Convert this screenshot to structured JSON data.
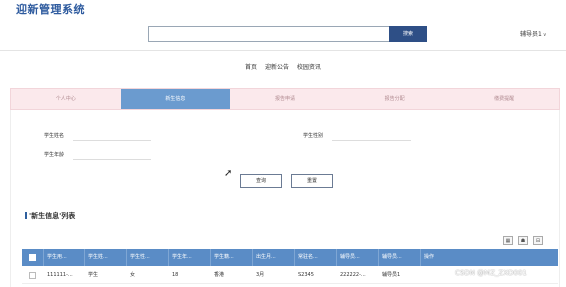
{
  "header": {
    "app_title": "迎新管理系统",
    "search_placeholder": "",
    "search_button": "搜索",
    "user_menu": "辅导员1",
    "user_menu_icon": "chevron-down-icon"
  },
  "main_nav": [
    "首页",
    "迎新公告",
    "校园资讯"
  ],
  "tabs": [
    {
      "label": "个人中心",
      "active": false
    },
    {
      "label": "新生信息",
      "active": true
    },
    {
      "label": "报告申请",
      "active": false
    },
    {
      "label": "报告分配",
      "active": false
    },
    {
      "label": "缴费提醒",
      "active": false
    }
  ],
  "filters": {
    "name_label": "学生姓名",
    "gender_label": "学生性别",
    "age_label": "学生年龄",
    "name_value": "",
    "gender_value": "",
    "age_value": ""
  },
  "buttons": {
    "query": "查询",
    "reset": "重置"
  },
  "section": {
    "title": "'新生信息'列表"
  },
  "toolbar_icons": [
    "table-icon",
    "user-icon",
    "print-icon"
  ],
  "table": {
    "columns": [
      "学生用...",
      "学生姓...",
      "学生性...",
      "学生年...",
      "学生籍...",
      "出生月...",
      "常驻名...",
      "辅导员...",
      "辅导员...",
      "操作"
    ],
    "rows": [
      [
        "111111-...",
        "学生",
        "女",
        "18",
        "香港",
        "3月",
        "S2345",
        "222222-...",
        "辅导员1",
        ""
      ]
    ]
  },
  "watermark": "CSDN @MZ_ZXD001"
}
